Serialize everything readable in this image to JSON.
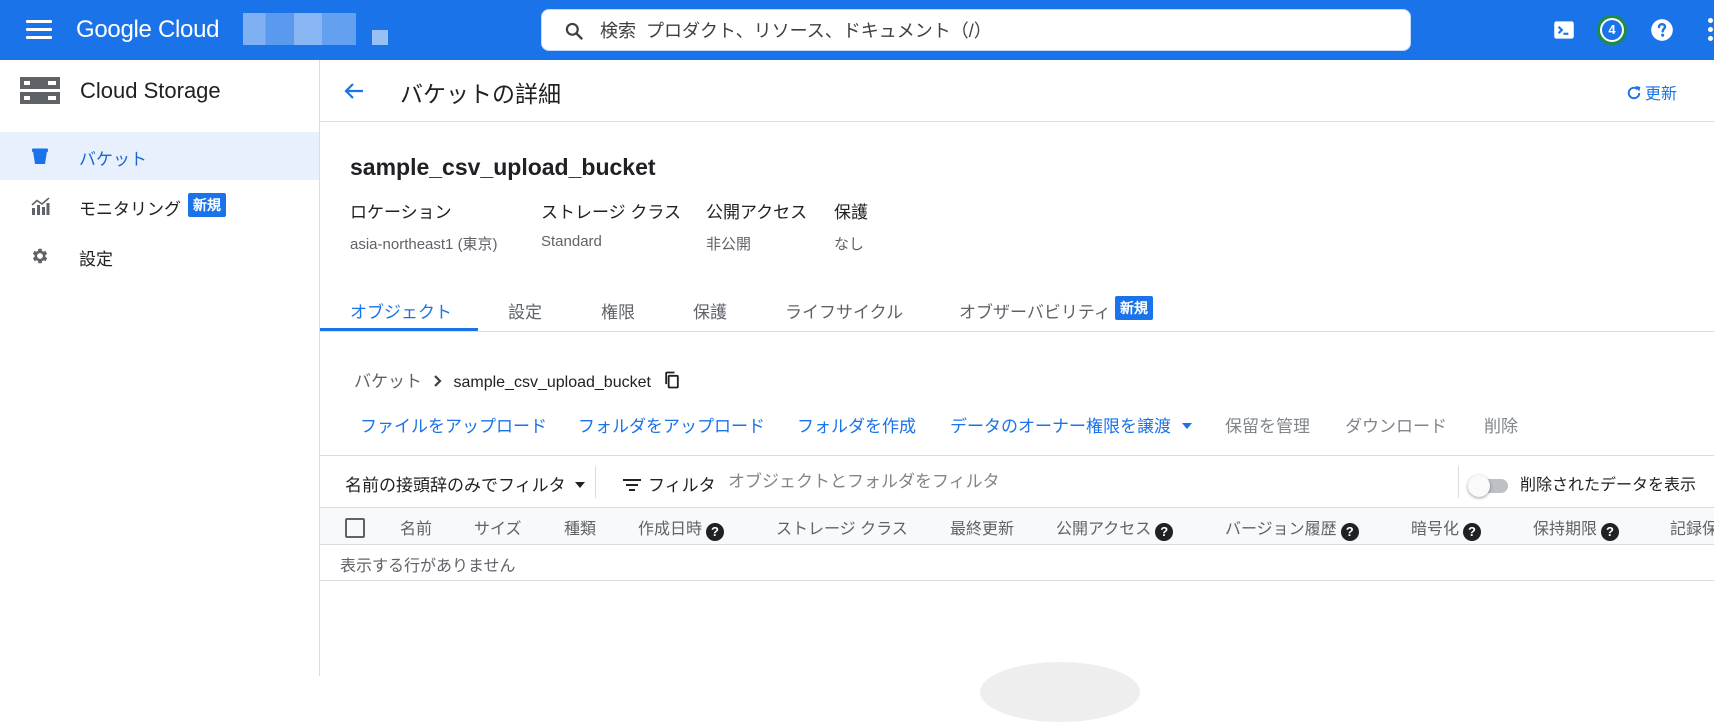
{
  "topbar": {
    "logo": "Google Cloud",
    "search_placeholder": "検索  プロダクト、リソース、ドキュメント（/）",
    "notification_count": "4",
    "icons": [
      "menu-icon",
      "search-icon",
      "terminal-icon",
      "help-icon",
      "more-vert-icon"
    ],
    "colors": {
      "bar": "#1a73e8",
      "badge_ring": "#1e8e3e"
    }
  },
  "sidebar": {
    "title": "Cloud Storage",
    "items": [
      {
        "label": "バケット",
        "icon": "bucket-icon",
        "active": true
      },
      {
        "label": "モニタリング",
        "icon": "monitoring-icon",
        "badge": "新規"
      },
      {
        "label": "設定",
        "icon": "gear-icon"
      }
    ]
  },
  "header": {
    "title": "バケットの詳細",
    "refresh_label": "更新"
  },
  "bucket": {
    "name": "sample_csv_upload_bucket",
    "meta": [
      {
        "key": "ロケーション",
        "value": "asia-northeast1 (東京)"
      },
      {
        "key": "ストレージ クラス",
        "value": "Standard"
      },
      {
        "key": "公開アクセス",
        "value": "非公開"
      },
      {
        "key": "保護",
        "value": "なし"
      }
    ]
  },
  "tabs": [
    {
      "label": "オブジェクト",
      "active": true
    },
    {
      "label": "設定"
    },
    {
      "label": "権限"
    },
    {
      "label": "保護"
    },
    {
      "label": "ライフサイクル"
    },
    {
      "label": "オブザーバビリティ",
      "badge": "新規"
    }
  ],
  "breadcrumb": {
    "root": "バケット",
    "current": "sample_csv_upload_bucket"
  },
  "actions": [
    {
      "label": "ファイルをアップロード",
      "enabled": true
    },
    {
      "label": "フォルダをアップロード",
      "enabled": true
    },
    {
      "label": "フォルダを作成",
      "enabled": true
    },
    {
      "label": "データのオーナー権限を譲渡",
      "enabled": true,
      "dropdown": true
    },
    {
      "label": "保留を管理",
      "enabled": false
    },
    {
      "label": "ダウンロード",
      "enabled": false
    },
    {
      "label": "削除",
      "enabled": false
    }
  ],
  "filter": {
    "prefix_select": "名前の接頭辞のみでフィルタ",
    "filter_label": "フィルタ",
    "filter_placeholder": "オブジェクトとフォルダをフィルタ",
    "show_deleted_label": "削除されたデータを表示",
    "show_deleted": false
  },
  "table": {
    "columns": [
      {
        "label": "名前"
      },
      {
        "label": "サイズ"
      },
      {
        "label": "種類"
      },
      {
        "label": "作成日時",
        "help": true
      },
      {
        "label": "ストレージ クラス"
      },
      {
        "label": "最終更新"
      },
      {
        "label": "公開アクセス",
        "help": true
      },
      {
        "label": "バージョン履歴",
        "help": true
      },
      {
        "label": "暗号化",
        "help": true
      },
      {
        "label": "保持期限",
        "help": true
      },
      {
        "label": "記録保"
      }
    ],
    "help_glyph": "?",
    "empty_message": "表示する行がありません"
  }
}
